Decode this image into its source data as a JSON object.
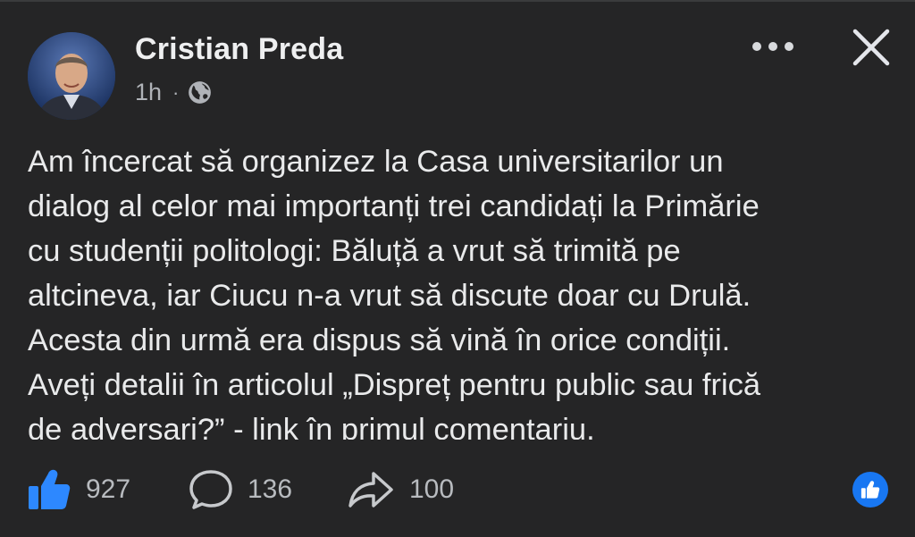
{
  "author": {
    "name": "Cristian Preda",
    "time": "1h",
    "separator": "·",
    "audience_icon": "globe-icon"
  },
  "header": {
    "more_icon": "more-horizontal-icon",
    "close_icon": "close-icon"
  },
  "post": {
    "text": "Am încercat să organizez la Casa universitarilor un\ndialog al celor mai importanți trei candidați la Primărie\ncu studenții politologi: Băluță a vrut să trimită pe\naltcineva, iar Ciucu n-a vrut să discute doar cu Drulă.\nAcesta din urmă era dispus să vină în orice condiții.\nAveți detalii în articolul „Dispreț pentru public sau frică\nde adversari?” - link în primul comentariu."
  },
  "actions": {
    "likes": "927",
    "comments": "136",
    "shares": "100",
    "like_icon": "thumbs-up-icon",
    "comment_icon": "comment-bubble-icon",
    "share_icon": "share-arrow-icon",
    "reaction_icon": "like-reaction-badge-icon"
  },
  "colors": {
    "background": "#252526",
    "text": "#e9eaeb",
    "secondary_text": "#b0b3b8",
    "like_blue": "#2d88ff",
    "reaction_blue": "#1877f2"
  }
}
